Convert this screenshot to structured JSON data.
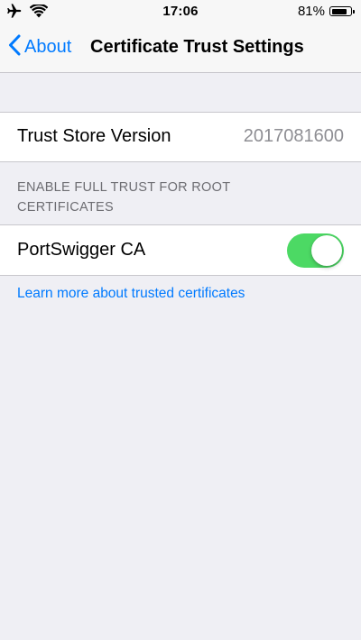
{
  "status_bar": {
    "time": "17:06",
    "battery_percent": "81%",
    "battery_level": 0.81,
    "icons": [
      "airplane-icon",
      "wifi-icon",
      "battery-icon"
    ]
  },
  "nav": {
    "back_label": "About",
    "title": "Certificate Trust Settings"
  },
  "trust_store": {
    "label": "Trust Store Version",
    "value": "2017081600"
  },
  "root_section": {
    "header": "ENABLE FULL TRUST FOR ROOT CERTIFICATES",
    "items": [
      {
        "label": "PortSwigger CA",
        "enabled": true
      }
    ]
  },
  "footer": {
    "link_text": "Learn more about trusted certificates"
  },
  "colors": {
    "accent": "#007aff",
    "toggle_on": "#4cd964",
    "background": "#efeff4"
  }
}
